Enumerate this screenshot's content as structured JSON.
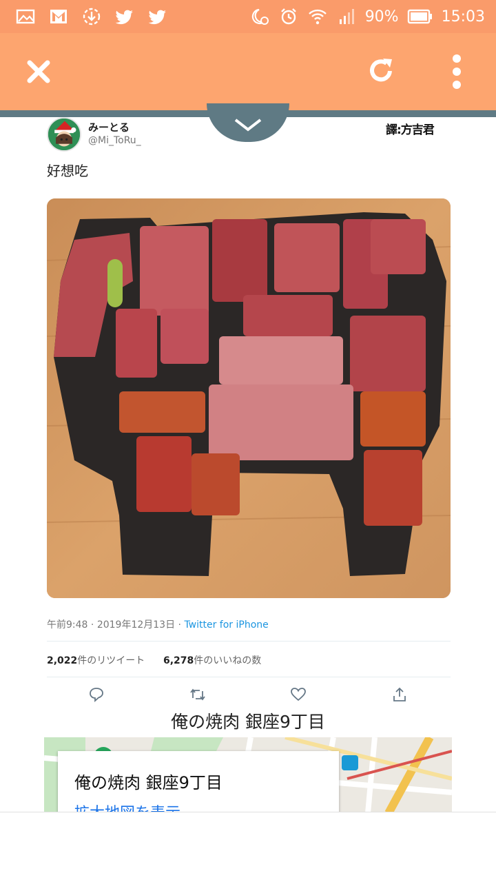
{
  "status_bar": {
    "battery": "90%",
    "time": "15:03",
    "left_icons": [
      "image-icon",
      "gmail-icon",
      "download-icon",
      "twitter-icon",
      "twitter-icon"
    ],
    "right_icons": [
      "night-alarm-icon",
      "alarm-icon",
      "wifi-icon",
      "signal-icon",
      "battery-icon"
    ]
  },
  "toolbar": {
    "close_icon": "close-icon",
    "refresh_icon": "refresh-icon",
    "more_icon": "more-vert-icon"
  },
  "tweet": {
    "display_name": "みーとる",
    "handle": "@Mi_ToRu_",
    "watermark": "譯:方吉君",
    "text": "好想吃",
    "time": "午前9:48",
    "date": "2019年12月13日",
    "separator": "·",
    "source": "Twitter for iPhone",
    "retweet_count": "2,022",
    "retweet_label": "件のリツイート",
    "like_count": "6,278",
    "like_label": "件のいいねの数",
    "actions": [
      "reply-icon",
      "retweet-icon",
      "like-icon",
      "share-icon"
    ]
  },
  "place": {
    "title": "俺の焼肉 銀座9丁目",
    "card_title": "俺の焼肉 銀座9丁目",
    "card_link": "拡大地図を表示"
  },
  "colors": {
    "status_bar": "#fa9b6a",
    "app_bar": "#fda56f",
    "link": "#1b95e0",
    "map_link": "#1a73e8"
  }
}
